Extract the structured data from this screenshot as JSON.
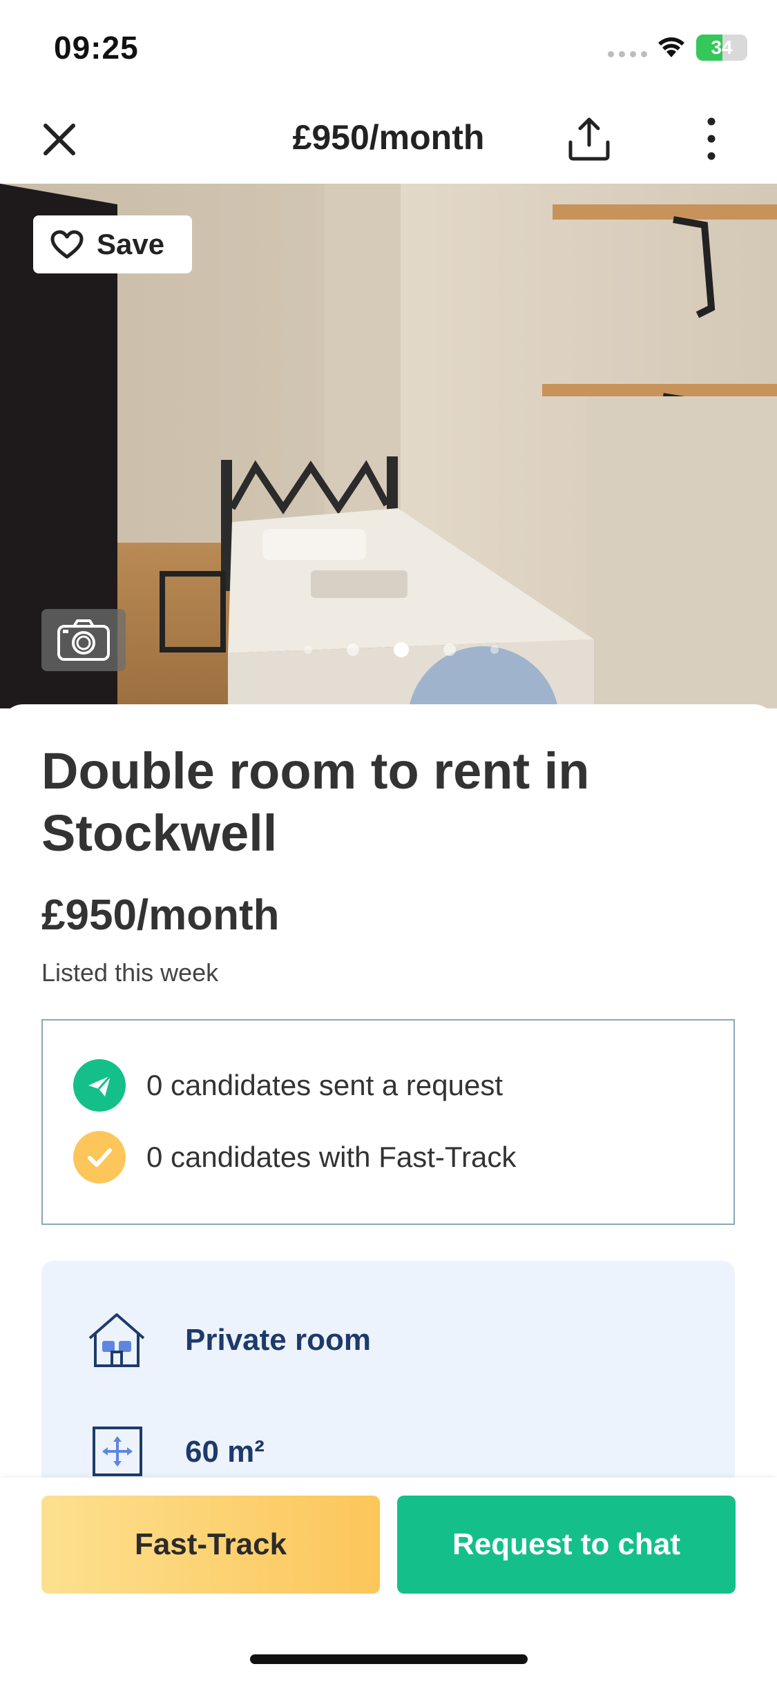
{
  "status_bar": {
    "time": "09:25",
    "battery": "34"
  },
  "header": {
    "title": "£950/month"
  },
  "photo": {
    "save_label": "Save",
    "page_count": 5,
    "active_index": 2
  },
  "listing": {
    "title": "Double room to rent in Stockwell",
    "price": "£950/month",
    "listed": "Listed this week"
  },
  "stats": [
    {
      "icon": "send-icon",
      "text": "0 candidates sent a request",
      "color": "#14bf8a"
    },
    {
      "icon": "check-icon",
      "text": "0 candidates with Fast-Track",
      "color": "#fcc65a"
    }
  ],
  "features": [
    {
      "icon": "house-icon",
      "text": "Private room"
    },
    {
      "icon": "area-icon",
      "text": "60 m²"
    }
  ],
  "actions": {
    "fast_track": "Fast-Track",
    "request_chat": "Request to chat"
  },
  "colors": {
    "accent_green": "#14bf8a",
    "accent_yellow": "#fcc65a",
    "feature_text": "#1e3a6a",
    "feature_bg": "#ecf3fc"
  }
}
